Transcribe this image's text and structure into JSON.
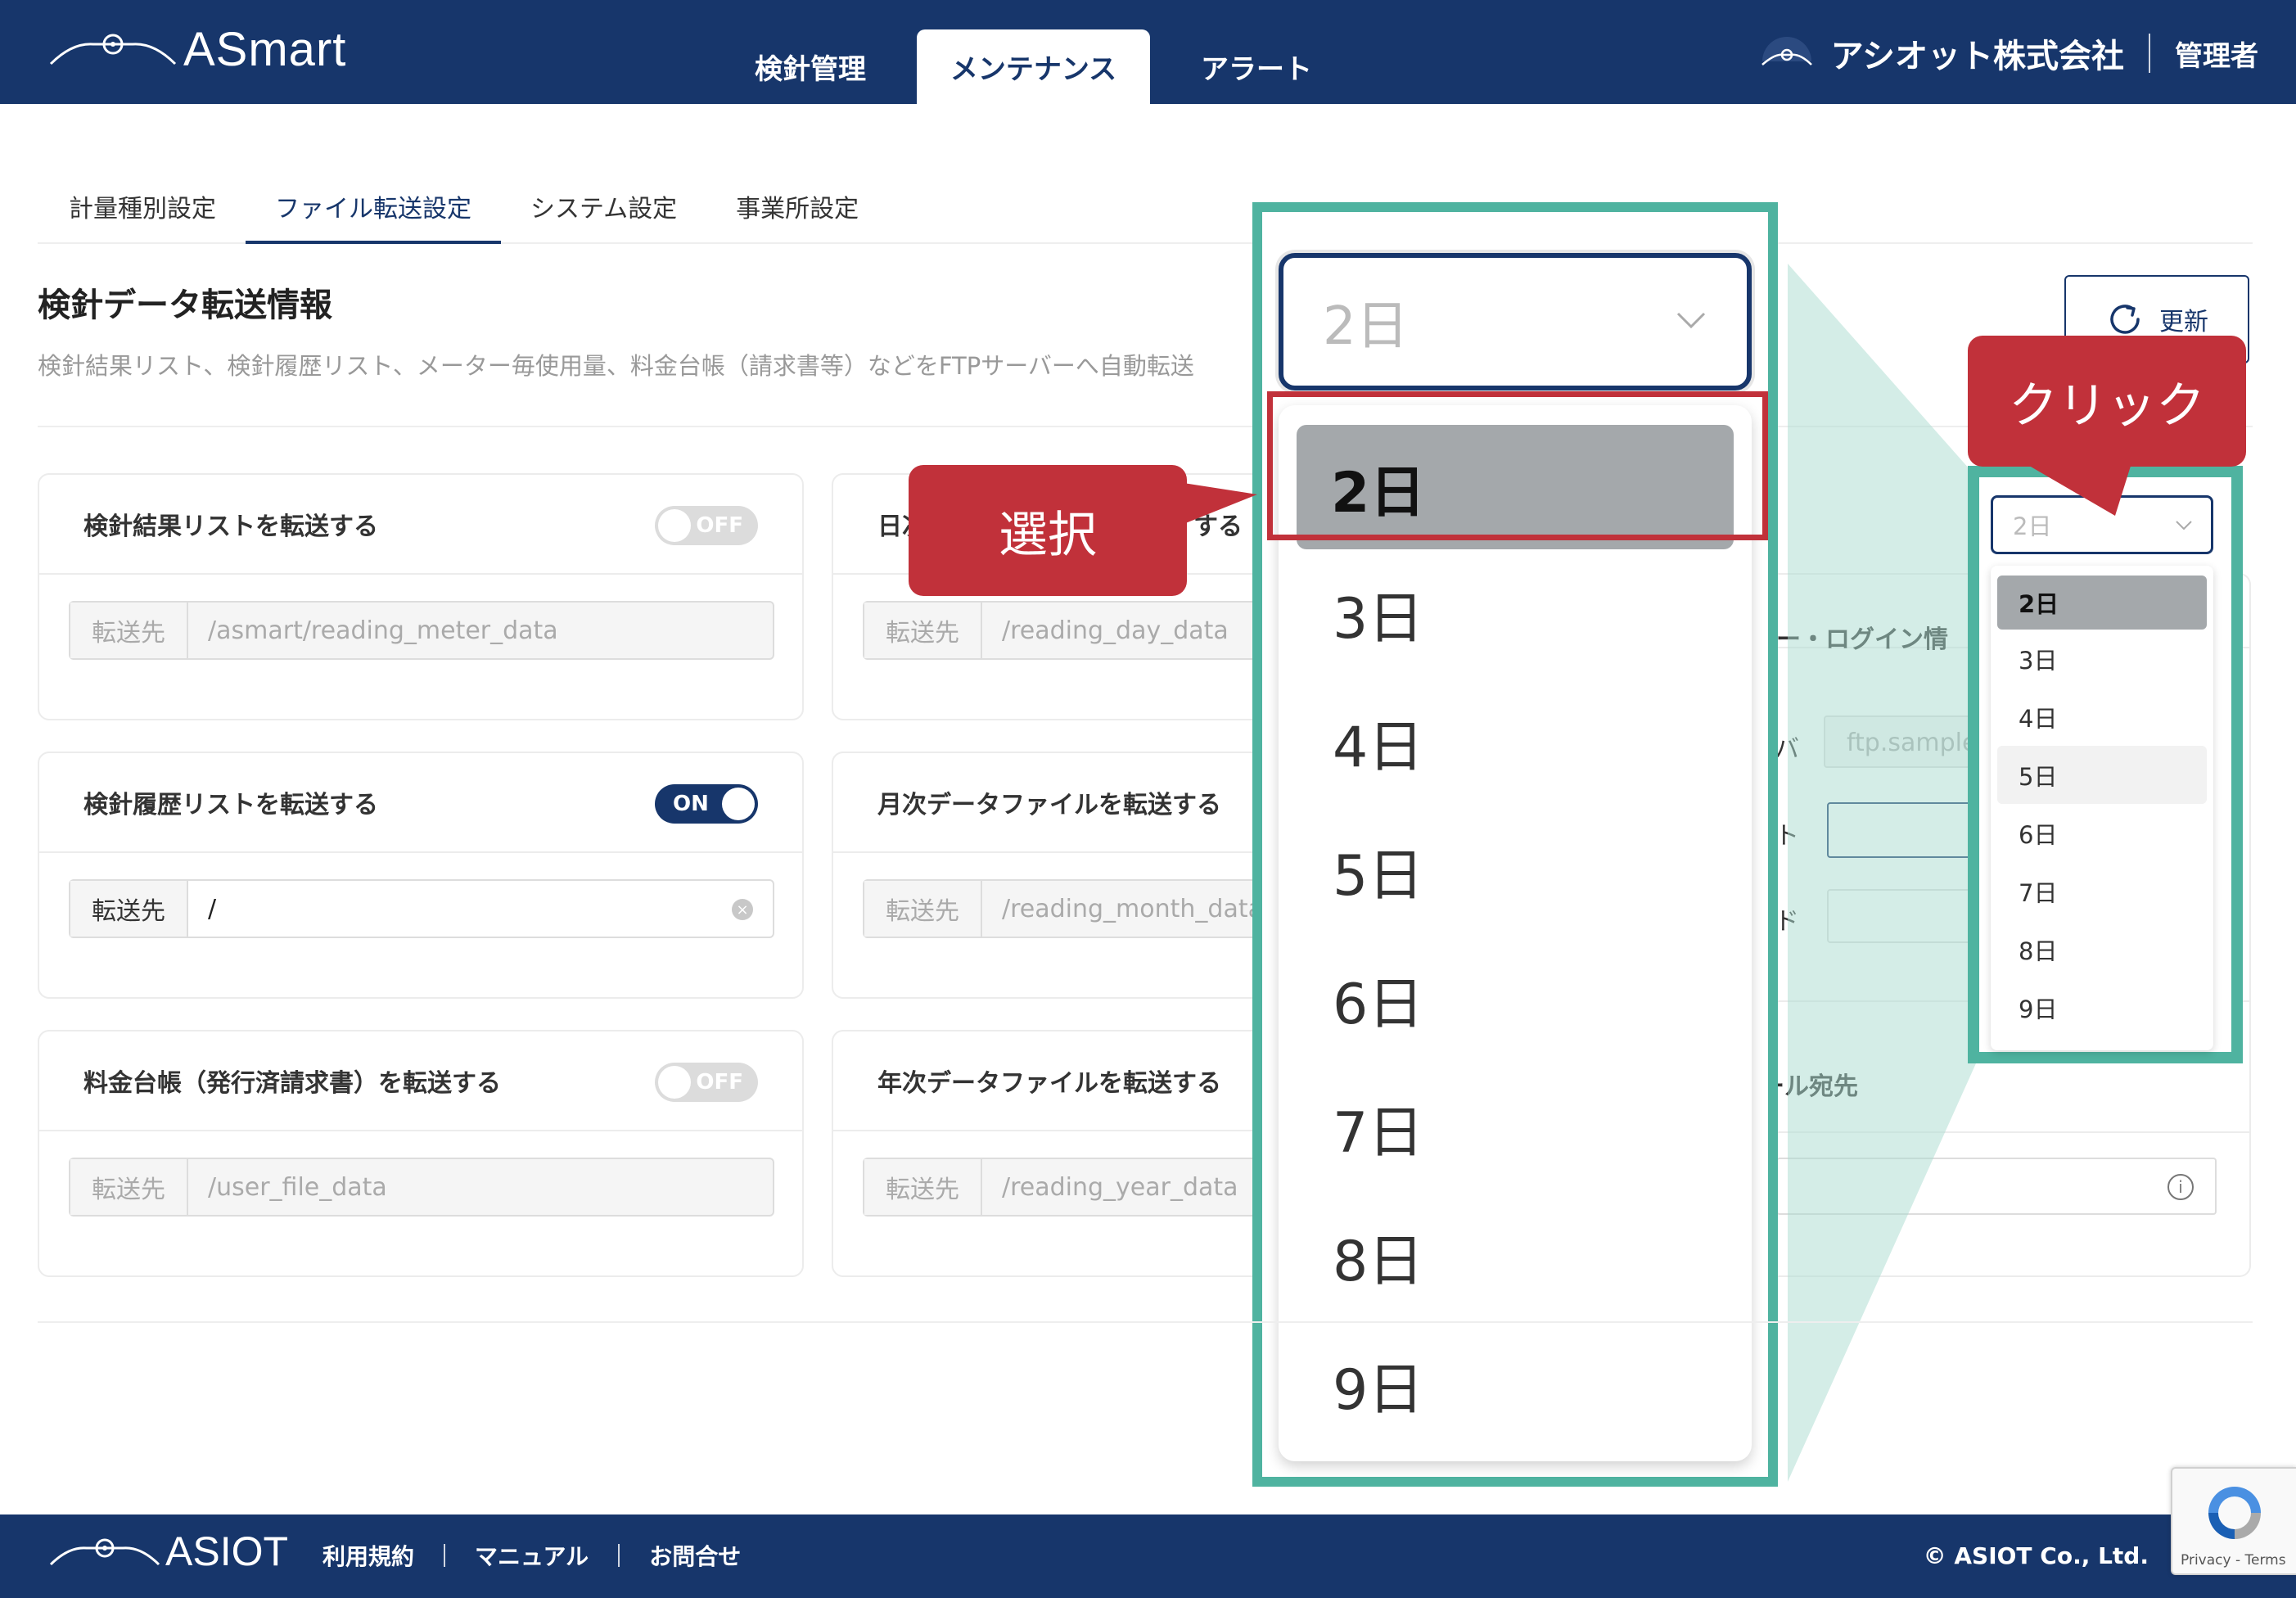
{
  "header": {
    "logo_text": "ASmart",
    "nav": [
      "検針管理",
      "メンテナンス",
      "アラート"
    ],
    "company": "アシオット株式会社",
    "user": "管理者"
  },
  "subtabs": [
    "計量種別設定",
    "ファイル転送設定",
    "システム設定",
    "事業所設定"
  ],
  "page": {
    "title": "検針データ転送情報",
    "description": "検針結果リスト、検針履歴リスト、メーター毎使用量、料金台帳（請求書等）などをFTPサーバーへ自動転送",
    "refresh_label": "更新"
  },
  "cards": [
    {
      "title": "検針結果リストを転送する",
      "toggle": "OFF",
      "label": "転送先",
      "value": "/asmart/reading_meter_data"
    },
    {
      "title": "日次",
      "title_tail": "する",
      "label": "転送先",
      "value": "/reading_day_data"
    },
    {
      "title": "検針履歴リストを転送する",
      "toggle": "ON",
      "label": "転送先",
      "value": "/"
    },
    {
      "title": "月次データファイルを転送する",
      "label": "転送先",
      "value": "/reading_month_data"
    },
    {
      "title": "料金台帳（発行済請求書）を転送する",
      "toggle": "OFF",
      "label": "転送先",
      "value": "/user_file_data"
    },
    {
      "title": "年次データファイルを転送する",
      "label": "転送先",
      "value": "/reading_year_data"
    }
  ],
  "right_panel": {
    "login_heading": "バー・ログイン情",
    "server_label": "バ",
    "server_value": "ftp.sample",
    "port_label": "ト",
    "password_label": "ド",
    "mail_heading": "ール宛先"
  },
  "dropdown": {
    "selected": "2日",
    "options": [
      "2日",
      "3日",
      "4日",
      "5日",
      "6日",
      "7日",
      "8日",
      "9日"
    ]
  },
  "callouts": {
    "select": "選択",
    "click": "クリック"
  },
  "footer": {
    "logo_text": "ASIOT",
    "links": [
      "利用規約",
      "マニュアル",
      "お問合せ"
    ],
    "copyright": "© ASIOT Co., Ltd.",
    "recaptcha": "Privacy - Terms"
  },
  "colors": {
    "brand": "#17366b",
    "accent_frame": "#4fb3a0",
    "callout": "#c1313a"
  }
}
